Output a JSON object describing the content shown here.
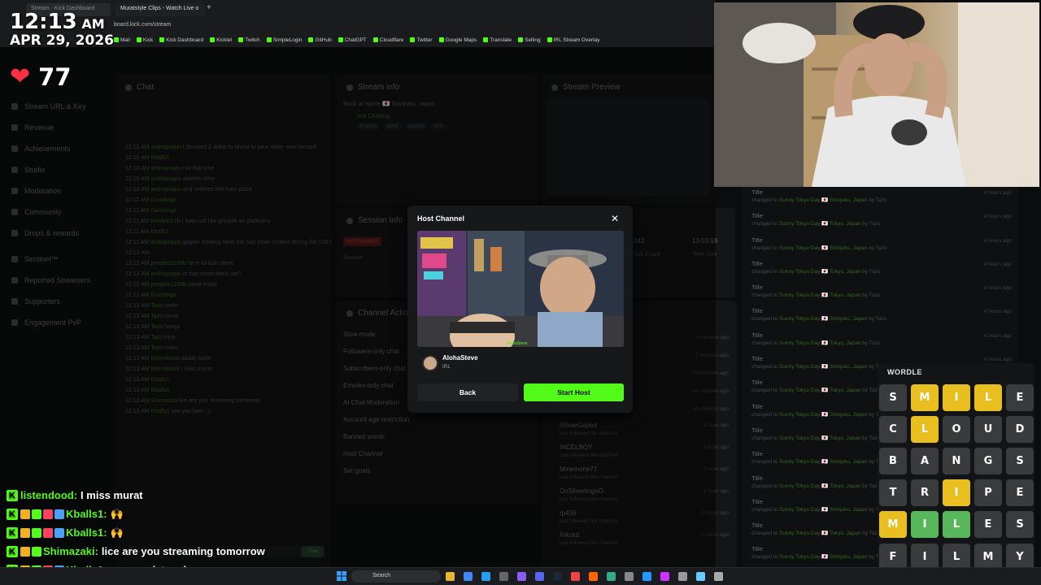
{
  "browser": {
    "tabs": [
      "Stream - Kick Dashboard",
      "Muratstyle Clips - Watch Live o"
    ],
    "url": "board.kick.com/stream",
    "bookmarks": [
      "Mail",
      "Kick",
      "Kick Dashboard",
      "Kicklet",
      "Twitch",
      "SimpleLogin",
      "GitHub",
      "ChatGPT",
      "Cloudflare",
      "Twitter",
      "Google Maps",
      "Translate",
      "Selling",
      "IRL Stream Overlay"
    ]
  },
  "overlay": {
    "time": "12:13",
    "ampm": "AM",
    "date": "APR 29, 2026",
    "heart_rate": "77"
  },
  "sidebar": {
    "items": [
      "Stream URL & Key",
      "Revenue",
      "Achievements",
      "Studio",
      "Moderation",
      "Community",
      "Drops & rewards"
    ],
    "items2": [
      "Sentinel™",
      "Reported Streamers",
      "Supporters",
      "Engagement PvP"
    ]
  },
  "panels": {
    "chat": "Chat",
    "stream_info": "Stream info",
    "stream_preview": "Stream Preview",
    "session_info": "Session Info",
    "channel_actions": "Channel Actions",
    "stream_title": "Back at home 🇯🇵 Shinjuku, Japan",
    "category": "Just Chatting",
    "tags": [
      "English",
      "adhd",
      "aussie",
      "chill"
    ],
    "session_status": "STREAMING",
    "session_labels": [
      "Session",
      "Sub Count",
      "Time Live"
    ],
    "session_values": [
      "242",
      "13:03:58"
    ],
    "actions": [
      "Slow mode",
      "Followers-only chat",
      "Subscribers-only chat",
      "Emotes-only chat",
      "AI Chat Moderation",
      "Account age restriction",
      "Banned words",
      "Host Channel",
      "Set goals"
    ]
  },
  "chat_log": [
    {
      "t": "12:10 AM",
      "u": "andrapoppu",
      "m": "I donated 2 dollar to Murat to pour water over himself"
    },
    {
      "t": "12:10 AM",
      "u": "Kballs1",
      "m": ""
    },
    {
      "t": "12:10 AM",
      "u": "andrapoppu",
      "m": "not that time"
    },
    {
      "t": "12:10 AM",
      "u": "andrapoppu",
      "m": "another time"
    },
    {
      "t": "12:10 AM",
      "u": "andrapoppu",
      "m": "and ordered him ham pizza"
    },
    {
      "t": "12:11 AM",
      "u": "Gunslinga",
      "m": ""
    },
    {
      "t": "12:11 AM",
      "u": "Gunslinga",
      "m": ""
    },
    {
      "t": "12:11 AM",
      "u": "Einstein27b",
      "m": "I hate cult like groupie on platforms"
    },
    {
      "t": "12:11 AM",
      "u": "Kballs1",
      "m": ""
    },
    {
      "t": "12:11 AM",
      "u": "andrapoppu",
      "m": "gagain stealing neds hat was peak content during the 100 days"
    },
    {
      "t": "12:12 AM",
      "u": "",
      "m": ""
    },
    {
      "t": "12:12 AM",
      "u": "peoples1168b",
      "m": "he'el turkish steve"
    },
    {
      "t": "12:12 AM",
      "u": "andrapoppu",
      "m": "is that count stack.ule?"
    },
    {
      "t": "12:12 AM",
      "u": "peoples1168b",
      "m": "same exact"
    },
    {
      "t": "12:12 AM",
      "u": "Gunslinga",
      "m": ""
    },
    {
      "t": "12:13 AM",
      "u": "Tazo",
      "m": "smile"
    },
    {
      "t": "12:13 AM",
      "u": "Tazo",
      "m": "cloud"
    },
    {
      "t": "12:13 AM",
      "u": "Tazo",
      "m": "bangs"
    },
    {
      "t": "12:13 AM",
      "u": "Tazo",
      "m": "tripe"
    },
    {
      "t": "12:13 AM",
      "u": "Tazo",
      "m": "miles"
    },
    {
      "t": "12:13 AM",
      "u": "listendoodz",
      "m": "daddy taste"
    },
    {
      "t": "12:13 AM",
      "u": "listendoodz",
      "m": "i miss murat"
    },
    {
      "t": "12:13 AM",
      "u": "Kballs1",
      "m": ""
    },
    {
      "t": "12:13 AM",
      "u": "Kballs1",
      "m": ""
    },
    {
      "t": "12:13 AM",
      "u": "Shimazaki",
      "m": "lice are you streaming tomorrow"
    },
    {
      "t": "12:13 AM",
      "u": "Kballs1",
      "m": "see you later. :)"
    }
  ],
  "chat_input": {
    "placeholder": "Send a message",
    "button": "Chat"
  },
  "modal": {
    "title": "Host Channel",
    "channel_name": "AlohaSteve",
    "category": "IRL",
    "thumb_watermark": "AlohaSteve",
    "back_label": "Back",
    "start_label": "Start Host",
    "close": "✕"
  },
  "activity": [
    {
      "title": "Title",
      "sub": "changed to ",
      "hl": "Sunny Tokyo Day 🇯🇵 Shinjuku, Japan",
      "by": " by Tazo",
      "ago": "4 hours ago"
    },
    {
      "title": "Title",
      "sub": "changed to ",
      "hl": "Sunny Tokyo Day 🇯🇵 Tokyo, Japan",
      "by": " by Tazo",
      "ago": "4 hours ago"
    },
    {
      "title": "Title",
      "sub": "changed to ",
      "hl": "Sunny Tokyo Day 🇯🇵 Shinjuku, Japan",
      "by": " by Tazo",
      "ago": "4 hours ago"
    },
    {
      "title": "Title",
      "sub": "changed to ",
      "hl": "Sunny Tokyo Day 🇯🇵 Tokyo, Japan",
      "by": " by Tazo",
      "ago": "4 hours ago"
    },
    {
      "title": "Title",
      "sub": "changed to ",
      "hl": "Sunny Tokyo Day 🇯🇵 Tokyo, Japan",
      "by": " by Tazo",
      "ago": "4 hours ago"
    },
    {
      "title": "Title",
      "sub": "changed to ",
      "hl": "Sunny Tokyo Day 🇯🇵 Shinjuku, Japan",
      "by": " by Tazo",
      "ago": "4 hours ago"
    },
    {
      "title": "Title",
      "sub": "changed to ",
      "hl": "Sunny Tokyo Day 🇯🇵 Tokyo, Japan",
      "by": " by Tazo",
      "ago": "4 hours ago"
    },
    {
      "title": "Title",
      "sub": "changed to ",
      "hl": "Sunny Tokyo Day 🇯🇵 Shinjuku, Japan",
      "by": " by Tazo",
      "ago": "4 hours ago"
    },
    {
      "title": "Title",
      "sub": "changed to ",
      "hl": "Sunny Tokyo Day 🇯🇵 Tokyo, Japan",
      "by": " by Tazo",
      "ago": "4 hours ago"
    },
    {
      "title": "Title",
      "sub": "changed to ",
      "hl": "Sunny Tokyo Day 🇯🇵 Shinjuku, Japan",
      "by": " by Tazo",
      "ago": "4 hours ago"
    },
    {
      "title": "Title",
      "sub": "changed to ",
      "hl": "Sunny Tokyo Day 🇯🇵 Tokyo, Japan",
      "by": " by Tazo",
      "ago": "4 hours ago"
    },
    {
      "title": "Title",
      "sub": "changed to ",
      "hl": "Sunny Tokyo Day 🇯🇵 Shinjuku, Japan",
      "by": " by Tazo",
      "ago": "4 hours ago"
    },
    {
      "title": "Title",
      "sub": "changed to ",
      "hl": "Sunny Tokyo Day 🇯🇵 Tokyo, Japan",
      "by": " by Tazo",
      "ago": "4 hours ago"
    },
    {
      "title": "Title",
      "sub": "changed to ",
      "hl": "Sunny Tokyo Day 🇯🇵 Shinjuku, Japan",
      "by": " by Tazo",
      "ago": "4 hours ago"
    },
    {
      "title": "Title",
      "sub": "changed to ",
      "hl": "Sunny Tokyo Day 🇯🇵 Tokyo, Japan",
      "by": " by Tazo",
      "ago": "4 hours ago"
    },
    {
      "title": "Title",
      "sub": "changed to ",
      "hl": "Sunny Tokyo Day 🇯🇵 Shinjuku, Japan",
      "by": " by Tazo",
      "ago": "4 hours ago"
    }
  ],
  "followers": [
    {
      "name": "iShowGaped",
      "sub": "just followed the channel",
      "ago": "1 hour ago"
    },
    {
      "name": "INCELBOY",
      "sub": "just followed the channel",
      "ago": "1 hour ago"
    },
    {
      "name": "Minemone77",
      "sub": "just followed the channel",
      "ago": "1 hour ago"
    },
    {
      "name": "OoSilverlingoO",
      "sub": "just followed the channel",
      "ago": "1 hour ago"
    },
    {
      "name": "rp436",
      "sub": "just followed the channel",
      "ago": "2 hours ago"
    },
    {
      "name": "Frkckd",
      "sub": "just followed the channel",
      "ago": "2 hours ago"
    }
  ],
  "recent_times": [
    "3 minutes ago",
    "7 minutes ago",
    "23 minutes ago",
    "34 minutes ago",
    "36 minutes ago"
  ],
  "chat_overlay": [
    {
      "name": "listendood:",
      "msg": "I miss murat",
      "badges": 0
    },
    {
      "name": "Kballs1:",
      "msg": "🙌",
      "badges": 4
    },
    {
      "name": "Kballs1:",
      "msg": "🙌",
      "badges": 4
    },
    {
      "name": "Shimazaki:",
      "msg": "lice are you streaming tomorrow",
      "badges": 2
    },
    {
      "name": "Kballs1:",
      "msg": "see you later. :)",
      "badges": 4
    }
  ],
  "wordle": {
    "title": "WORDLE",
    "rows": [
      [
        {
          "l": "S",
          "s": "absent"
        },
        {
          "l": "M",
          "s": "present"
        },
        {
          "l": "I",
          "s": "present"
        },
        {
          "l": "L",
          "s": "present"
        },
        {
          "l": "E",
          "s": "absent"
        }
      ],
      [
        {
          "l": "C",
          "s": "absent"
        },
        {
          "l": "L",
          "s": "present"
        },
        {
          "l": "O",
          "s": "absent"
        },
        {
          "l": "U",
          "s": "absent"
        },
        {
          "l": "D",
          "s": "absent"
        }
      ],
      [
        {
          "l": "B",
          "s": "absent"
        },
        {
          "l": "A",
          "s": "absent"
        },
        {
          "l": "N",
          "s": "absent"
        },
        {
          "l": "G",
          "s": "absent"
        },
        {
          "l": "S",
          "s": "absent"
        }
      ],
      [
        {
          "l": "T",
          "s": "absent"
        },
        {
          "l": "R",
          "s": "absent"
        },
        {
          "l": "I",
          "s": "present"
        },
        {
          "l": "P",
          "s": "absent"
        },
        {
          "l": "E",
          "s": "absent"
        }
      ],
      [
        {
          "l": "M",
          "s": "present"
        },
        {
          "l": "I",
          "s": "correct"
        },
        {
          "l": "L",
          "s": "correct"
        },
        {
          "l": "E",
          "s": "absent"
        },
        {
          "l": "S",
          "s": "absent"
        }
      ],
      [
        {
          "l": "F",
          "s": "absent"
        },
        {
          "l": "I",
          "s": "absent"
        },
        {
          "l": "L",
          "s": "absent"
        },
        {
          "l": "M",
          "s": "absent"
        },
        {
          "l": "Y",
          "s": "absent"
        }
      ]
    ],
    "colors": {
      "absent": "#3a3b3d",
      "present": "#e9be1f",
      "correct": "#58b75a"
    }
  },
  "taskbar": {
    "search": "Search",
    "apps": [
      "folder-icon",
      "chrome-icon",
      "vscode-icon",
      "terminal-icon",
      "obs-icon",
      "discord-icon",
      "steam-icon",
      "app-icon",
      "app-icon",
      "app-icon",
      "app-icon",
      "app-icon",
      "app-icon",
      "app-icon",
      "app-icon",
      "app-icon"
    ]
  },
  "colors": {
    "kick_green": "#53fc18",
    "heart": "#ff3040"
  }
}
